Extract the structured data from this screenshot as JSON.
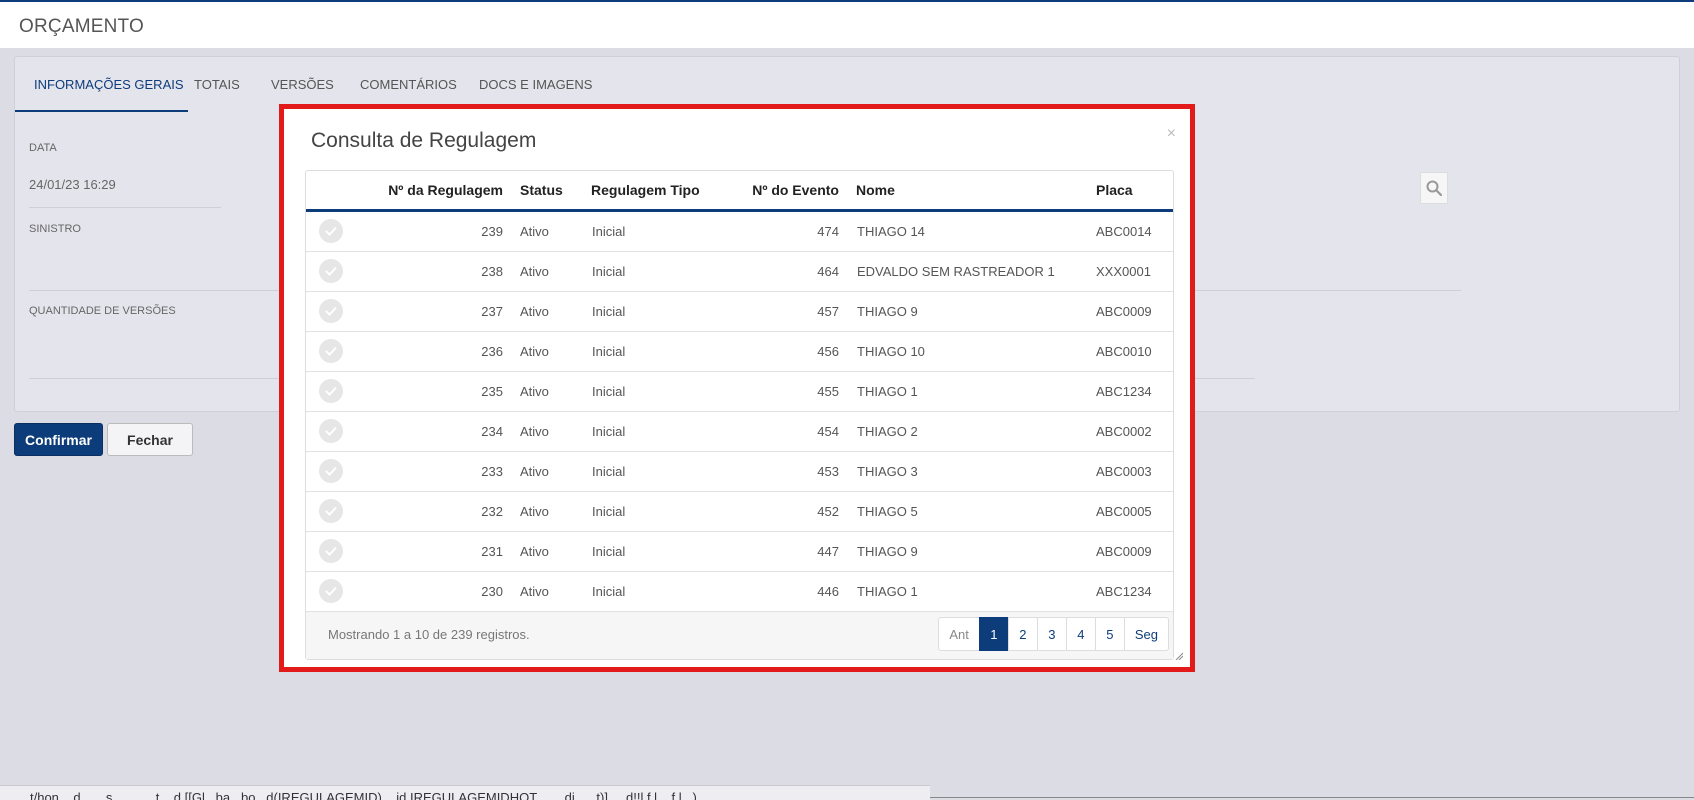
{
  "header": {
    "title": "ORÇAMENTO"
  },
  "tabs": [
    "INFORMAÇÕES GERAIS",
    "TOTAIS",
    "VERSÕES",
    "COMENTÁRIOS",
    "DOCS E IMAGENS"
  ],
  "form": {
    "date_label": "DATA",
    "date_value": "24/01/23 16:29",
    "sinistro_label": "SINISTRO",
    "versions_label": "QUANTIDADE DE VERSÕES"
  },
  "buttons": {
    "confirm": "Confirmar",
    "close": "Fechar"
  },
  "modal": {
    "title": "Consulta de Regulagem",
    "close_symbol": "×",
    "columns": [
      "Nº da Regulagem",
      "Status",
      "Regulagem Tipo",
      "Nº do Evento",
      "Nome",
      "Placa"
    ],
    "rows": [
      [
        "239",
        "Ativo",
        "Inicial",
        "474",
        "THIAGO 14",
        "ABC0014"
      ],
      [
        "238",
        "Ativo",
        "Inicial",
        "464",
        "EDVALDO SEM RASTREADOR 1",
        "XXX0001"
      ],
      [
        "237",
        "Ativo",
        "Inicial",
        "457",
        "THIAGO 9",
        "ABC0009"
      ],
      [
        "236",
        "Ativo",
        "Inicial",
        "456",
        "THIAGO 10",
        "ABC0010"
      ],
      [
        "235",
        "Ativo",
        "Inicial",
        "455",
        "THIAGO 1",
        "ABC1234"
      ],
      [
        "234",
        "Ativo",
        "Inicial",
        "454",
        "THIAGO 2",
        "ABC0002"
      ],
      [
        "233",
        "Ativo",
        "Inicial",
        "453",
        "THIAGO 3",
        "ABC0003"
      ],
      [
        "232",
        "Ativo",
        "Inicial",
        "452",
        "THIAGO 5",
        "ABC0005"
      ],
      [
        "231",
        "Ativo",
        "Inicial",
        "447",
        "THIAGO 9",
        "ABC0009"
      ],
      [
        "230",
        "Ativo",
        "Inicial",
        "446",
        "THIAGO 1",
        "ABC1234"
      ]
    ],
    "footer_info": "Mostrando 1 a 10 de 239 registros.",
    "pagination": [
      "Ant",
      "1",
      "2",
      "3",
      "4",
      "5",
      "Seg"
    ],
    "active_page": "1"
  },
  "bottom_bar": {
    "text": "t/hon... d... ...s ... .......t ...d [[Gl...ba...bo...d(IREGULAGEMID) ...id IREGULAGEMIDHOT.... ...di... ..t)] ....d!!l f.l... f.l...)"
  },
  "colors": {
    "primary": "#0d3c7a",
    "highlight": "#e31a1a",
    "background": "#dcdce5"
  }
}
